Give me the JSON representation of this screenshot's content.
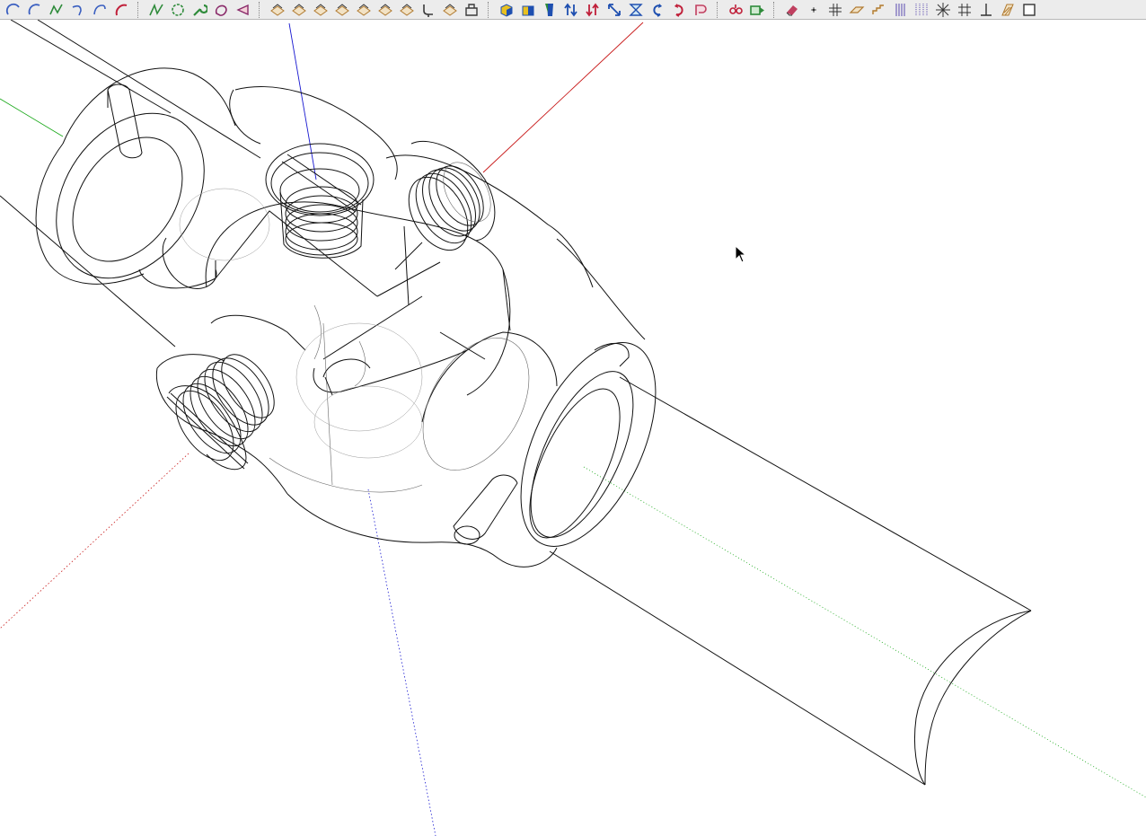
{
  "toolbar": {
    "groups": [
      {
        "name": "drawing-curves",
        "tools": [
          {
            "icon": "arc-icon",
            "color": "#3a5fc0"
          },
          {
            "icon": "arc-2pt-icon",
            "color": "#3a5fc0"
          },
          {
            "icon": "freehand-icon",
            "color": "#2e8b3a"
          },
          {
            "icon": "curve-icon",
            "color": "#3a5fc0"
          },
          {
            "icon": "arc-3pt-icon",
            "color": "#3a5fc0"
          },
          {
            "icon": "pie-icon",
            "color": "#c0203a"
          }
        ]
      },
      {
        "name": "drawing-shapes",
        "tools": [
          {
            "icon": "polyline-icon",
            "color": "#2e8b3a"
          },
          {
            "icon": "polygon-icon",
            "color": "#2e8b3a"
          },
          {
            "icon": "wrench-icon",
            "color": "#2e8b3a"
          },
          {
            "icon": "blob-icon",
            "color": "#8a2a6a"
          },
          {
            "icon": "sector-icon",
            "color": "#8a2a6a"
          }
        ]
      },
      {
        "name": "surface-tools",
        "tools": [
          {
            "icon": "surface-1-icon",
            "color": "#b07a30"
          },
          {
            "icon": "surface-2-icon",
            "color": "#b07a30"
          },
          {
            "icon": "surface-3-icon",
            "color": "#b07a30"
          },
          {
            "icon": "surface-4-icon",
            "color": "#b07a30"
          },
          {
            "icon": "surface-5-icon",
            "color": "#b07a30"
          },
          {
            "icon": "surface-6-icon",
            "color": "#b07a30"
          },
          {
            "icon": "surface-7-icon",
            "color": "#b07a30"
          },
          {
            "icon": "pipe-icon",
            "color": "#3a3a3a"
          },
          {
            "icon": "surface-8-icon",
            "color": "#b07a30"
          },
          {
            "icon": "frame-icon",
            "color": "#3a3a3a"
          }
        ]
      },
      {
        "name": "solid-tools",
        "tools": [
          {
            "icon": "cube-icon",
            "color": "#1e4fb0"
          },
          {
            "icon": "box-icon",
            "color": "#1e4fb0"
          },
          {
            "icon": "extrude-icon",
            "color": "#1e4fb0"
          },
          {
            "icon": "push-up-icon",
            "color": "#1e4fb0"
          },
          {
            "icon": "push-down-icon",
            "color": "#c0203a"
          },
          {
            "icon": "stretch-icon",
            "color": "#1e4fb0"
          },
          {
            "icon": "hourglass-icon",
            "color": "#1e4fb0"
          },
          {
            "icon": "rotate-left-icon",
            "color": "#1e4fb0"
          },
          {
            "icon": "rotate-right-icon",
            "color": "#c0203a"
          },
          {
            "icon": "shape-icon",
            "color": "#c04060"
          }
        ]
      },
      {
        "name": "move-tools",
        "tools": [
          {
            "icon": "move-icon",
            "color": "#c0203a"
          },
          {
            "icon": "play-icon",
            "color": "#2e8b3a"
          }
        ]
      },
      {
        "name": "construction-tools",
        "tools": [
          {
            "icon": "eraser-icon",
            "color": "#c04060"
          },
          {
            "icon": "point-icon",
            "color": "#333333"
          },
          {
            "icon": "grid-icon",
            "color": "#333333"
          },
          {
            "icon": "plane-icon",
            "color": "#b07a30"
          },
          {
            "icon": "stairs-icon",
            "color": "#b07a30"
          },
          {
            "icon": "parallel-icon",
            "color": "#5a4ab0"
          },
          {
            "icon": "dotted-grid-icon",
            "color": "#5a4ab0"
          },
          {
            "icon": "star-lines-icon",
            "color": "#333333"
          },
          {
            "icon": "hash-icon",
            "color": "#333333"
          },
          {
            "icon": "perpendicular-icon",
            "color": "#333333"
          },
          {
            "icon": "hatch-icon",
            "color": "#b07a30"
          },
          {
            "icon": "square-icon",
            "color": "#333333"
          }
        ]
      }
    ]
  },
  "viewport": {
    "background": "#ffffff",
    "model_line_color": "#111111",
    "hidden_line_color": "#8c8c8c",
    "axes": {
      "red": "#d01818",
      "green": "#18a818",
      "blue": "#1818d0"
    }
  },
  "cursor": {
    "icon": "arrow-cursor-icon"
  }
}
